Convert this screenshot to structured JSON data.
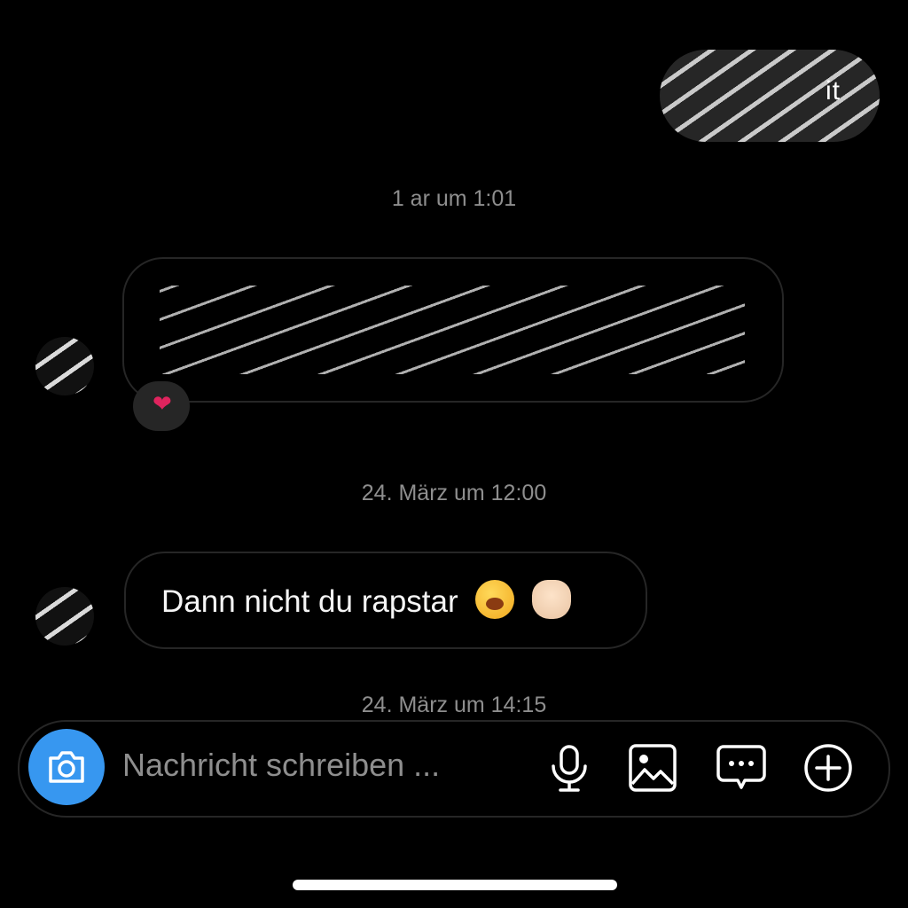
{
  "thread": {
    "sent_message_partial": "it",
    "timestamps": [
      "1  ar  um  1:01",
      "24. März um 12:00",
      "24. März um 14:15"
    ],
    "messages": [
      {
        "text": "Dann nicht du rapstar",
        "emojis": [
          "yawning-face",
          "waving-hand"
        ]
      }
    ],
    "reaction": "❤"
  },
  "composer": {
    "placeholder": "Nachricht schreiben ...",
    "icons": [
      "camera-icon",
      "microphone-icon",
      "gallery-icon",
      "sticker-icon",
      "plus-icon"
    ]
  },
  "colors": {
    "background": "#000000",
    "accent": "#3797f0",
    "bubble_border": "#262626",
    "timestamp_text": "#8e8e8e"
  }
}
